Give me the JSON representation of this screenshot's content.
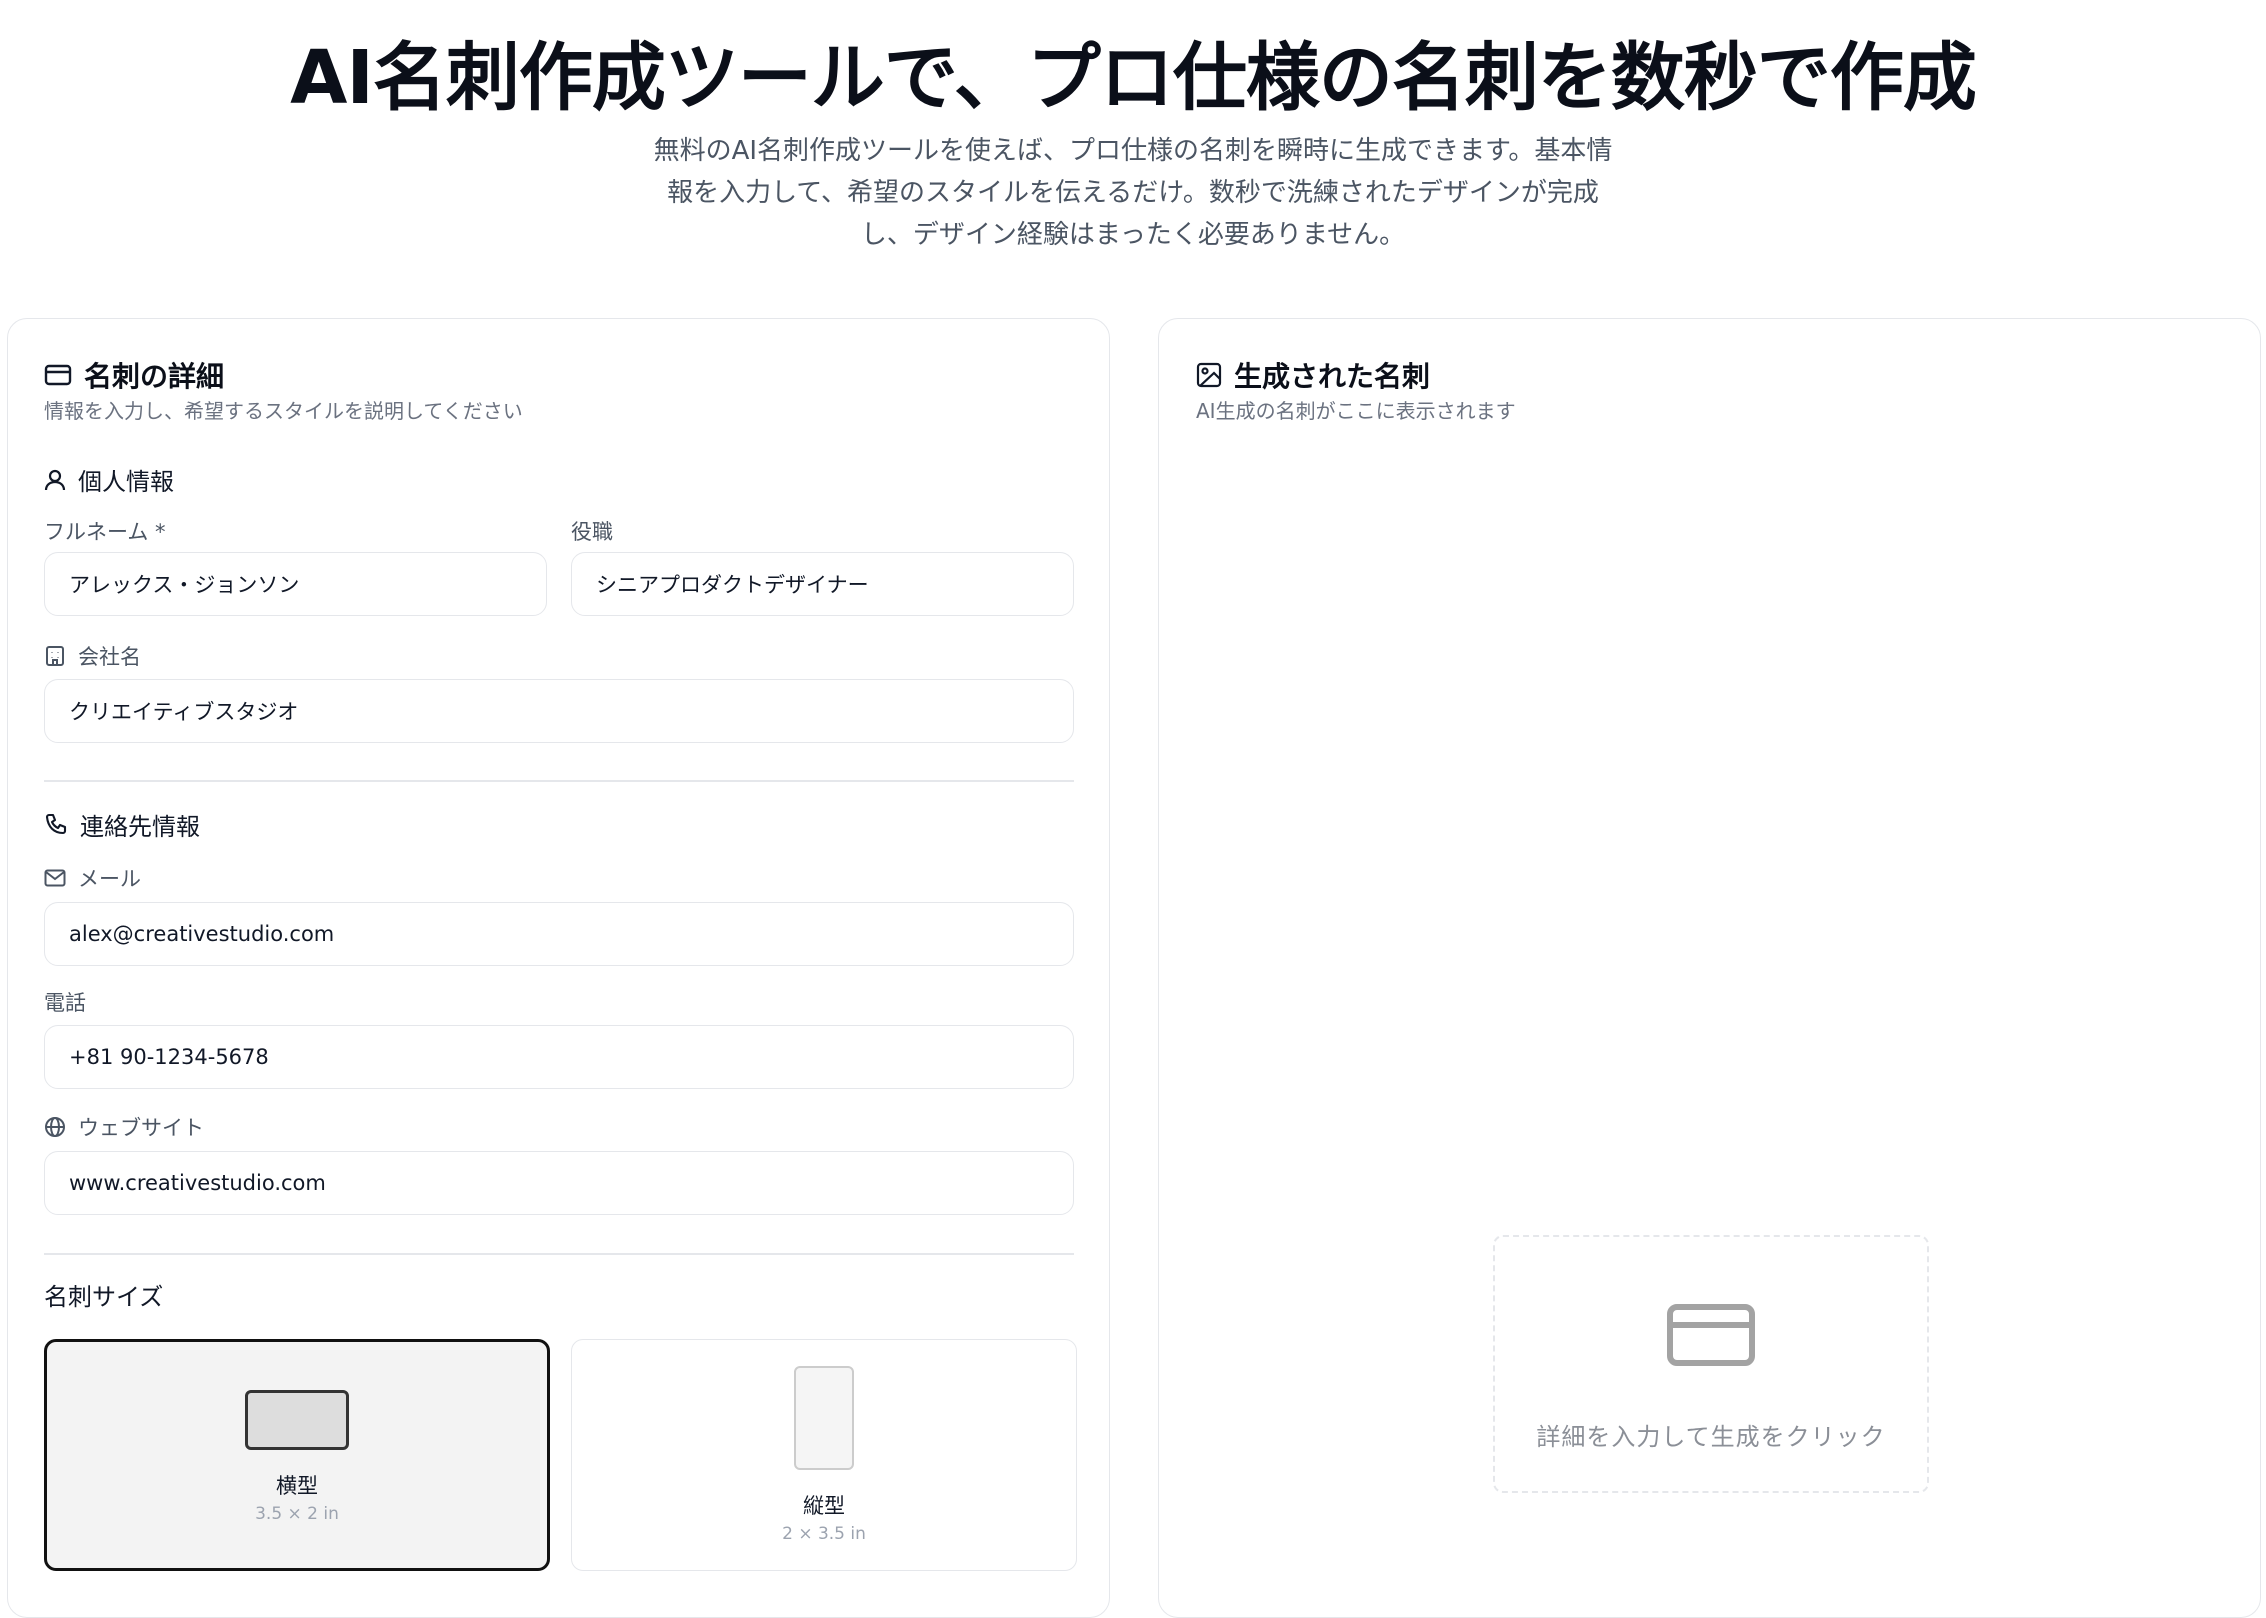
{
  "hero": {
    "title": "AI名刺作成ツールで、プロ仕様の名刺を数秒で作成",
    "subtitle_lines": [
      "無料のAI名刺作成ツールを使えば、プロ仕様の名刺を瞬時に生成できます。基本情",
      "報を入力して、希望のスタイルを伝えるだけ。数秒で洗練されたデザインが完成",
      "し、デザイン経験はまったく必要ありません。"
    ]
  },
  "form": {
    "title": "名刺の詳細",
    "description": "情報を入力し、希望するスタイルを説明してください",
    "personal": {
      "heading": "個人情報",
      "full_name_label": "フルネーム *",
      "full_name_value": "アレックス・ジョンソン",
      "job_title_label": "役職",
      "job_title_value": "シニアプロダクトデザイナー",
      "company_label": "会社名",
      "company_value": "クリエイティブスタジオ"
    },
    "contact": {
      "heading": "連絡先情報",
      "email_label": "メール",
      "email_value": "alex@creativestudio.com",
      "phone_label": "電話",
      "phone_value": "+81 90-1234-5678",
      "website_label": "ウェブサイト",
      "website_value": "www.creativestudio.com"
    },
    "size": {
      "heading": "名刺サイズ",
      "options": [
        {
          "name": "横型",
          "dims": "3.5 × 2 in",
          "selected": true
        },
        {
          "name": "縦型",
          "dims": "2 × 3.5 in",
          "selected": false
        }
      ]
    }
  },
  "preview": {
    "title": "生成された名刺",
    "description": "AI生成の名刺がここに表示されます",
    "placeholder": "詳細を入力して生成をクリック"
  },
  "icons": {
    "form_title": "credit-card-icon",
    "personal": "user-icon",
    "company": "building-icon",
    "contact": "phone-icon",
    "email": "mail-icon",
    "website": "globe-icon",
    "preview_title": "image-icon",
    "placeholder": "credit-card-icon"
  }
}
